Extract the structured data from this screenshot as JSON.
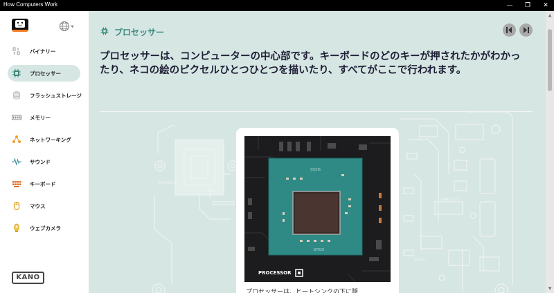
{
  "window": {
    "title": "How Computers Work",
    "controls": {
      "minimize": "—",
      "maximize": "❐",
      "close": "✕"
    }
  },
  "sidebar": {
    "logo": "kano-face-logo",
    "language_icon": "globe-icon",
    "items": [
      {
        "label": "バイナリー",
        "icon": "binary-icon",
        "active": false
      },
      {
        "label": "プロセッサー",
        "icon": "processor-icon",
        "active": true
      },
      {
        "label": "フラッシュストレージ",
        "icon": "storage-icon",
        "active": false
      },
      {
        "label": "メモリー",
        "icon": "memory-icon",
        "active": false
      },
      {
        "label": "ネットワーキング",
        "icon": "network-icon",
        "active": false
      },
      {
        "label": "サウンド",
        "icon": "sound-icon",
        "active": false
      },
      {
        "label": "キーボード",
        "icon": "keyboard-icon",
        "active": false
      },
      {
        "label": "マウス",
        "icon": "mouse-icon",
        "active": false
      },
      {
        "label": "ウェブカメラ",
        "icon": "webcam-icon",
        "active": false
      }
    ],
    "brand": "KANO"
  },
  "main": {
    "section_title": "プロセッサー",
    "headline": "プロセッサーは、コンピューターの中心部です。キーボードのどのキーが押されたかがわかったり、ネコの絵のピクセルひとつひとつを描いたり、すべてがここで行われます。",
    "card": {
      "chip_label": "PROCESSOR",
      "caption": "プロセッサーは、ヒートシンクの下に隠"
    }
  },
  "colors": {
    "accent": "#3a8a7c",
    "background": "#d6e6e3",
    "active_item": "#d6e6e3",
    "logo_orange": "#f57a1f"
  }
}
